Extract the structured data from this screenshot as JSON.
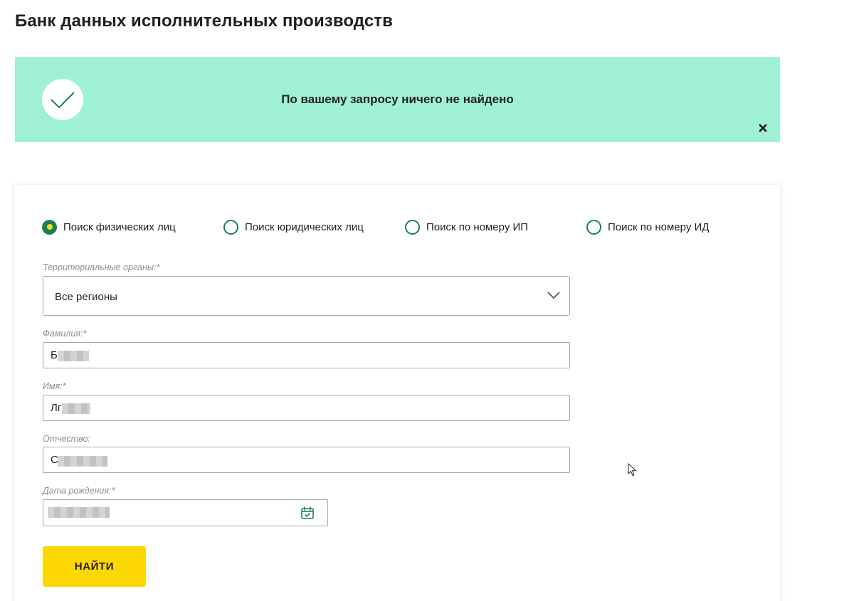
{
  "page": {
    "title": "Банк данных исполнительных производств"
  },
  "alert": {
    "message": "По вашему запросу ничего не найдено",
    "bg_color": "#a0f1d3",
    "icon": "checkmark-icon",
    "close_icon": "close-icon"
  },
  "search_type": {
    "options": [
      {
        "label": "Поиск физических лиц",
        "checked": true
      },
      {
        "label": "Поиск юридических лиц",
        "checked": false
      },
      {
        "label": "Поиск по номеру ИП",
        "checked": false
      },
      {
        "label": "Поиск по номеру ИД",
        "checked": false
      }
    ],
    "accent_color": "#1b7e5b"
  },
  "form": {
    "region": {
      "label": "Территориальные органы:*",
      "value": "Все регионы"
    },
    "last_name": {
      "label": "Фамилия:*",
      "value": "Б"
    },
    "first_name": {
      "label": "Имя:*",
      "value": "Лг"
    },
    "patronymic": {
      "label": "Отчество:",
      "value": "С"
    },
    "birth_date": {
      "label": "Дата рождения:*",
      "value": ""
    },
    "submit_label": "НАЙТИ",
    "submit_color": "#fdd800"
  }
}
